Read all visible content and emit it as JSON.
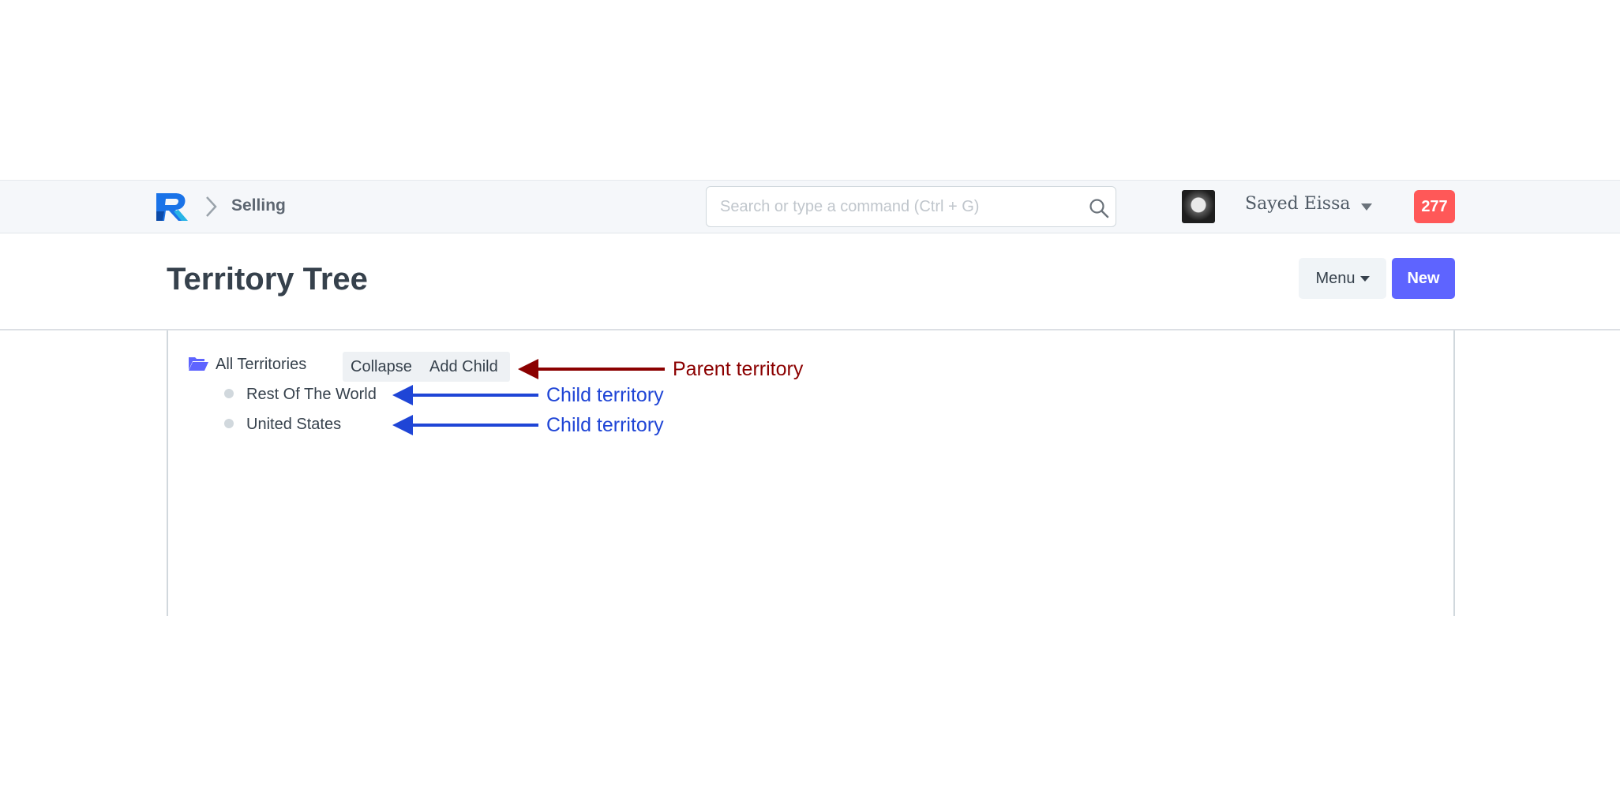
{
  "header": {
    "breadcrumb_label": "Selling",
    "search_placeholder": "Search or type a command (Ctrl + G)",
    "user_name": "Sayed Eissa",
    "notification_count": "277"
  },
  "page": {
    "title": "Territory Tree",
    "menu_label": "Menu",
    "new_label": "New"
  },
  "tree": {
    "root": {
      "label": "All Territories",
      "actions": [
        "Collapse",
        "Add Child"
      ]
    },
    "children": [
      "Rest Of The World",
      "United States"
    ]
  },
  "annotations": {
    "parent": "Parent territory",
    "child_1": "Child territory",
    "child_2": "Child territory"
  },
  "colors": {
    "navbar_bg": "#f5f7fa",
    "accent": "#5e64ff",
    "notification": "#ff5858",
    "annotation_parent": "#8b0000",
    "annotation_child": "#1f45d6"
  },
  "icons": {
    "logo": "app-logo",
    "breadcrumb_separator": "chevron-right-icon",
    "search": "search-icon",
    "user_menu": "caret-down-icon",
    "tree_root": "folder-open-icon",
    "tree_leaf": "bullet-icon",
    "annotation": "arrow-left-icon"
  }
}
